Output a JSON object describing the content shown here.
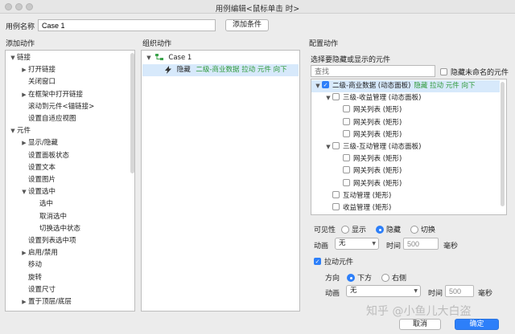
{
  "window": {
    "title": "用例编辑<鼠标单击 时>"
  },
  "case_name": {
    "label": "用例名称",
    "value": "Case 1",
    "add_condition": "添加条件"
  },
  "left": {
    "header": "添加动作",
    "items": [
      {
        "label": "链接",
        "level": 0,
        "arrow": "▼"
      },
      {
        "label": "打开链接",
        "level": 1,
        "arrow": "▶"
      },
      {
        "label": "关闭窗口",
        "level": 1,
        "arrow": ""
      },
      {
        "label": "在框架中打开链接",
        "level": 1,
        "arrow": "▶"
      },
      {
        "label": "滚动到元件<锚链接>",
        "level": 1,
        "arrow": ""
      },
      {
        "label": "设置自适应视图",
        "level": 1,
        "arrow": ""
      },
      {
        "label": "元件",
        "level": 0,
        "arrow": "▼"
      },
      {
        "label": "显示/隐藏",
        "level": 1,
        "arrow": "▶"
      },
      {
        "label": "设置面板状态",
        "level": 1,
        "arrow": ""
      },
      {
        "label": "设置文本",
        "level": 1,
        "arrow": ""
      },
      {
        "label": "设置图片",
        "level": 1,
        "arrow": ""
      },
      {
        "label": "设置选中",
        "level": 1,
        "arrow": "▼"
      },
      {
        "label": "选中",
        "level": 2,
        "arrow": ""
      },
      {
        "label": "取消选中",
        "level": 2,
        "arrow": ""
      },
      {
        "label": "切换选中状态",
        "level": 2,
        "arrow": ""
      },
      {
        "label": "设置列表选中项",
        "level": 1,
        "arrow": ""
      },
      {
        "label": "启用/禁用",
        "level": 1,
        "arrow": "▶"
      },
      {
        "label": "移动",
        "level": 1,
        "arrow": ""
      },
      {
        "label": "旋转",
        "level": 1,
        "arrow": ""
      },
      {
        "label": "设置尺寸",
        "level": 1,
        "arrow": ""
      },
      {
        "label": "置于顶层/底层",
        "level": 1,
        "arrow": "▶"
      }
    ]
  },
  "middle": {
    "header": "组织动作",
    "case_label": "Case 1",
    "action": {
      "verb": "隐藏",
      "detail": "二级-商业数据 拉动 元件 向下"
    }
  },
  "right": {
    "header": "配置动作",
    "subheader": "选择要隐藏或显示的元件",
    "search_placeholder": "查找",
    "hide_unnamed": "隐藏未命名的元件",
    "tree": [
      {
        "level": 0,
        "arrow": "▼",
        "checked": true,
        "label": "二级-商业数据 (动态面板)",
        "extra": "隐藏 拉动 元件 向下"
      },
      {
        "level": 1,
        "arrow": "▼",
        "checked": false,
        "label": "三级-收益管理 (动态面板)",
        "extra": ""
      },
      {
        "level": 2,
        "arrow": "",
        "checked": false,
        "label": "网关列表 (矩形)",
        "extra": ""
      },
      {
        "level": 2,
        "arrow": "",
        "checked": false,
        "label": "网关列表 (矩形)",
        "extra": ""
      },
      {
        "level": 2,
        "arrow": "",
        "checked": false,
        "label": "网关列表 (矩形)",
        "extra": ""
      },
      {
        "level": 1,
        "arrow": "▼",
        "checked": false,
        "label": "三级-互动管理 (动态面板)",
        "extra": ""
      },
      {
        "level": 2,
        "arrow": "",
        "checked": false,
        "label": "网关列表 (矩形)",
        "extra": ""
      },
      {
        "level": 2,
        "arrow": "",
        "checked": false,
        "label": "网关列表 (矩形)",
        "extra": ""
      },
      {
        "level": 2,
        "arrow": "",
        "checked": false,
        "label": "网关列表 (矩形)",
        "extra": ""
      },
      {
        "level": 1,
        "arrow": "",
        "checked": false,
        "label": "互动管理 (矩形)",
        "extra": ""
      },
      {
        "level": 1,
        "arrow": "",
        "checked": false,
        "label": "收益管理 (矩形)",
        "extra": ""
      }
    ],
    "visibility": {
      "label": "可见性",
      "show": "显示",
      "hide": "隐藏",
      "toggle": "切换",
      "selected": "隐藏"
    },
    "anim1": {
      "label": "动画",
      "value": "无",
      "time_label": "时间",
      "time_value": "500",
      "unit": "毫秒"
    },
    "drag": {
      "label": "拉动元件",
      "checked": true
    },
    "direction": {
      "label": "方向",
      "down": "下方",
      "right": "右侧",
      "selected": "下方"
    },
    "anim2": {
      "label": "动画",
      "value": "无",
      "time_label": "时间",
      "time_value": "500",
      "unit": "毫秒"
    }
  },
  "footer": {
    "cancel": "取消",
    "ok": "确定",
    "watermark": "知乎 @小鱼儿大白盗"
  },
  "colors": {
    "accent": "#2d7ff9",
    "selection": "#d7e9fb",
    "green": "#2f9a3a"
  }
}
